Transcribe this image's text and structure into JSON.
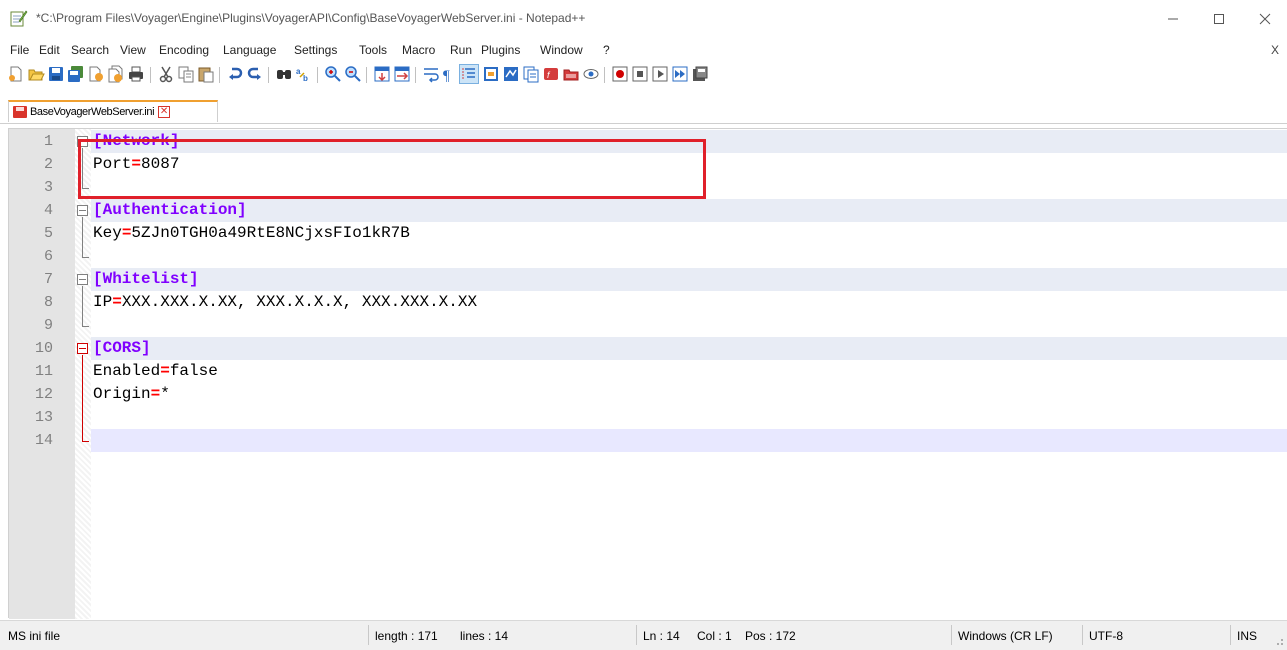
{
  "window": {
    "title": "*C:\\Program Files\\Voyager\\Engine\\Plugins\\VoyagerAPI\\Config\\BaseVoyagerWebServer.ini - Notepad++",
    "minimize_glyph": "—",
    "maximize_glyph": "☐",
    "close_glyph": "✕"
  },
  "menu": {
    "items": [
      "File",
      "Edit",
      "Search",
      "View",
      "Encoding",
      "Language",
      "Settings",
      "Tools",
      "Macro",
      "Run",
      "Plugins",
      "Window",
      "?"
    ],
    "close_label": "X"
  },
  "toolbar": {
    "icons": [
      "new-file-icon",
      "open-file-icon",
      "save-icon",
      "save-all-icon",
      "close-icon",
      "close-all-icon",
      "print-icon",
      "cut-icon",
      "copy-icon",
      "paste-icon",
      "undo-icon",
      "redo-icon",
      "find-icon",
      "replace-icon",
      "zoom-in-icon",
      "zoom-out-icon",
      "sync-vertical-icon",
      "sync-horizontal-icon",
      "word-wrap-icon",
      "show-all-chars-icon",
      "indent-guide-icon",
      "user-language-icon",
      "document-map-icon",
      "function-list-icon",
      "folder-workspace-icon",
      "monitoring-icon",
      "record-macro-icon",
      "stop-record-icon",
      "play-macro-icon",
      "run-macro-multiple-icon",
      "save-macro-icon"
    ]
  },
  "tab": {
    "label": "BaseVoyagerWebServer.ini",
    "close_glyph": "✕"
  },
  "editor": {
    "lines": [
      {
        "num": "1",
        "parts": [
          {
            "t": "[Network]",
            "c": "sec"
          }
        ]
      },
      {
        "num": "2",
        "parts": [
          {
            "t": "Port",
            "c": ""
          },
          {
            "t": "=",
            "c": "eq"
          },
          {
            "t": "8087",
            "c": ""
          }
        ]
      },
      {
        "num": "3",
        "parts": []
      },
      {
        "num": "4",
        "parts": [
          {
            "t": "[Authentication]",
            "c": "sec"
          }
        ]
      },
      {
        "num": "5",
        "parts": [
          {
            "t": "Key",
            "c": ""
          },
          {
            "t": "=",
            "c": "eq"
          },
          {
            "t": "5ZJn0TGH0a49RtE8NCjxsFIo1kR7B",
            "c": ""
          }
        ]
      },
      {
        "num": "6",
        "parts": []
      },
      {
        "num": "7",
        "parts": [
          {
            "t": "[Whitelist]",
            "c": "sec"
          }
        ]
      },
      {
        "num": "8",
        "parts": [
          {
            "t": "IP",
            "c": ""
          },
          {
            "t": "=",
            "c": "eq"
          },
          {
            "t": "XXX.XXX.X.XX, XXX.X.X.X, XXX.XXX.X.XX",
            "c": ""
          }
        ]
      },
      {
        "num": "9",
        "parts": []
      },
      {
        "num": "10",
        "parts": [
          {
            "t": "[CORS]",
            "c": "sec"
          }
        ]
      },
      {
        "num": "11",
        "parts": [
          {
            "t": "Enabled",
            "c": ""
          },
          {
            "t": "=",
            "c": "eq"
          },
          {
            "t": "false",
            "c": ""
          }
        ]
      },
      {
        "num": "12",
        "parts": [
          {
            "t": "Origin",
            "c": ""
          },
          {
            "t": "=",
            "c": "eq"
          },
          {
            "t": "*",
            "c": ""
          }
        ]
      },
      {
        "num": "13",
        "parts": []
      },
      {
        "num": "14",
        "parts": []
      }
    ],
    "section_lines": [
      1,
      4,
      7,
      10
    ],
    "current_line": 14
  },
  "statusbar": {
    "file_type": "MS ini file",
    "length": "length : 171",
    "lines": "lines : 14",
    "ln": "Ln : 14",
    "col": "Col : 1",
    "pos": "Pos : 172",
    "eol": "Windows (CR LF)",
    "encoding": "UTF-8",
    "mode": "INS"
  },
  "colors": {
    "section": "#8000ff",
    "operator": "#ff0000",
    "highlight_box": "#e0202a",
    "tab_accent": "#f0a030"
  }
}
